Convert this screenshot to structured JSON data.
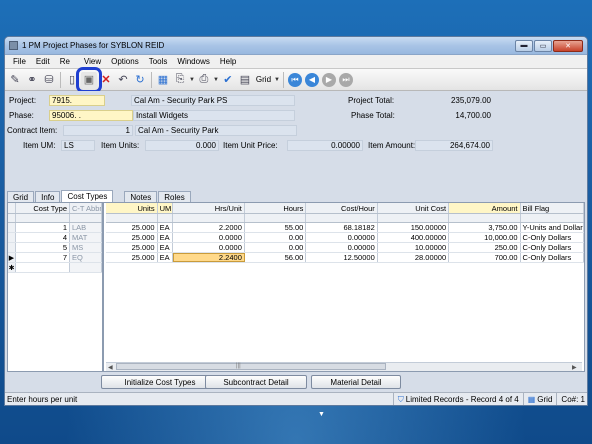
{
  "window": {
    "title": "1 PM Project Phases for SYBLON REID"
  },
  "menu": [
    "File",
    "Edit",
    "Re",
    "View",
    "Options",
    "Tools",
    "Windows",
    "Help"
  ],
  "toolbar": {
    "grid_label": "Grid",
    "highlight_color": "#1f3fd1"
  },
  "header": {
    "project_label": "Project:",
    "project_value": "7915.",
    "project_desc": "Cal Am - Security Park PS",
    "project_total_label": "Project Total:",
    "project_total_value": "235,079.00",
    "phase_label": "Phase:",
    "phase_value": "95006.  .",
    "phase_desc": "Install Widgets",
    "phase_total_label": "Phase Total:",
    "phase_total_value": "14,700.00",
    "contract_item_label": "Contract Item:",
    "contract_item_value": "1",
    "contract_item_desc": "Cal Am - Security Park",
    "item_um_label": "Item UM:",
    "item_um_value": "LS",
    "item_units_label": "Item Units:",
    "item_units_value": "0.000",
    "item_unit_price_label": "Item Unit Price:",
    "item_unit_price_value": "0.00000",
    "item_amount_label": "Item Amount:",
    "item_amount_value": "264,674.00"
  },
  "tabs": [
    "Grid",
    "Info",
    "Cost Types",
    "Notes",
    "Roles"
  ],
  "active_tab": "Cost Types",
  "grid": {
    "left_headers": [
      "Cost Type",
      "C-T Abbr"
    ],
    "right_headers": [
      "Units",
      "UM",
      "Hrs/Unit",
      "Hours",
      "Cost/Hour",
      "Unit Cost",
      "Amount",
      "Bill Flag"
    ],
    "rows": [
      {
        "marker": "",
        "cost_type": "1",
        "abbr": "LAB",
        "units": "25.000",
        "um": "EA",
        "hrs_unit": "2.2000",
        "hours": "55.00",
        "cost_hour": "68.18182",
        "unit_cost": "150.00000",
        "amount": "3,750.00",
        "bill_flag": "Y-Units and Dollars"
      },
      {
        "marker": "",
        "cost_type": "4",
        "abbr": "MAT",
        "units": "25.000",
        "um": "EA",
        "hrs_unit": "0.0000",
        "hours": "0.00",
        "cost_hour": "0.00000",
        "unit_cost": "400.00000",
        "amount": "10,000.00",
        "bill_flag": "C-Only Dollars"
      },
      {
        "marker": "",
        "cost_type": "5",
        "abbr": "MS",
        "units": "25.000",
        "um": "EA",
        "hrs_unit": "0.0000",
        "hours": "0.00",
        "cost_hour": "0.00000",
        "unit_cost": "10.00000",
        "amount": "250.00",
        "bill_flag": "C-Only Dollars"
      },
      {
        "marker": "▶",
        "cost_type": "7",
        "abbr": "EQ",
        "units": "25.000",
        "um": "EA",
        "hrs_unit": "2.2400",
        "hours": "56.00",
        "cost_hour": "12.50000",
        "unit_cost": "28.00000",
        "amount": "700.00",
        "bill_flag": "C-Only Dollars"
      }
    ],
    "new_row_marker": "✱"
  },
  "buttons": {
    "init": "Initialize Cost Types",
    "subcontract": "Subcontract Detail",
    "material": "Material Detail"
  },
  "status": {
    "hint": "Enter hours per unit",
    "records": "Limited Records - Record 4 of 4",
    "grid": "Grid",
    "company": "Co#: 1"
  }
}
